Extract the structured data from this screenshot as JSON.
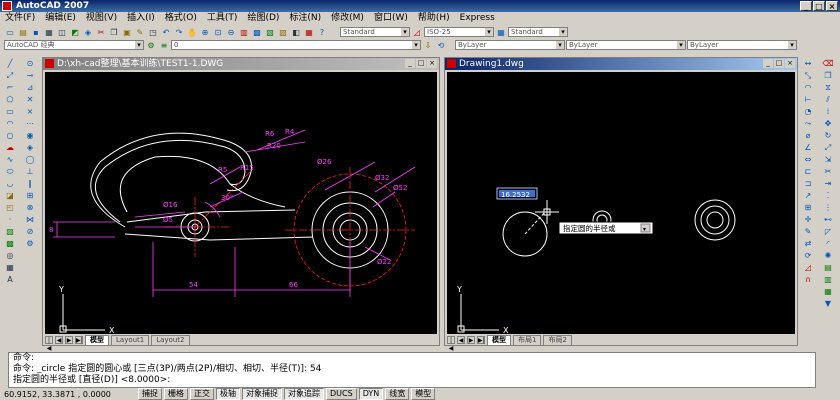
{
  "app": {
    "title": "AutoCAD 2007"
  },
  "menu": [
    "文件(F)",
    "编辑(E)",
    "视图(V)",
    "插入(I)",
    "格式(O)",
    "工具(T)",
    "绘图(D)",
    "标注(N)",
    "修改(M)",
    "窗口(W)",
    "帮助(H)",
    "Express"
  ],
  "toolbar": {
    "workspace": "AutoCAD 经典",
    "layer_value": "0",
    "text_style": "Standard",
    "dim_style": "ISO-25",
    "table_style": "Standard",
    "color": "ByLayer",
    "linetype": "ByLayer",
    "lineweight": "ByLayer"
  },
  "windows": {
    "left": {
      "title": "D:\\xh-cad整理\\基本训练\\TEST1-1.DWG",
      "tabs": [
        "模型",
        "Layout1",
        "Layout2"
      ]
    },
    "right": {
      "title": "Drawing1.dwg",
      "tabs": [
        "模型",
        "布局1",
        "布局2"
      ]
    }
  },
  "drawing_left": {
    "dims": [
      "R5",
      "R15",
      "R6",
      "R4",
      "R20",
      "Ø16",
      "Ø5",
      "30°",
      "Ø26",
      "Ø32",
      "Ø52",
      "Ø22",
      "8",
      "54",
      "66"
    ],
    "ucs": [
      "Y",
      "X"
    ]
  },
  "drawing_right": {
    "dynamic_input_value": "16.2532",
    "tooltip": "指定圆的半径或",
    "ucs": [
      "Y",
      "X"
    ]
  },
  "command_lines": [
    "命令:",
    "命令: _circle 指定圆的圆心或 [三点(3P)/两点(2P)/相切、相切、半径(T)]: 54",
    "指定圆的半径或 [直径(D)] <8.0000>:"
  ],
  "status": {
    "coords": "60.9152, 33.3871 , 0.0000",
    "buttons": [
      "捕捉",
      "栅格",
      "正交",
      "极轴",
      "对象捕捉",
      "对象追踪",
      "DUCS",
      "DYN",
      "线宽",
      "模型"
    ]
  }
}
